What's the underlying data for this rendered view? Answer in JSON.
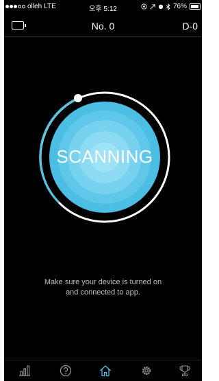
{
  "status_bar": {
    "carrier": "olleh",
    "network": "LTE",
    "time": "오후 5:12",
    "battery_percent": "76%",
    "battery_level": 0.76
  },
  "header": {
    "device_battery_icon": "battery-icon",
    "title": "No. 0",
    "day": "D-0"
  },
  "scanner": {
    "label": "SCANNING",
    "accent_color": "#4fc3e6"
  },
  "message": {
    "line1": "Make sure your device is turned on",
    "line2": "and connected to app."
  },
  "bottom_nav": {
    "items": [
      {
        "icon": "chart-icon",
        "active": false
      },
      {
        "icon": "help-icon",
        "active": false
      },
      {
        "icon": "home-icon",
        "active": true
      },
      {
        "icon": "settings-icon",
        "active": false
      },
      {
        "icon": "trophy-icon",
        "active": false
      }
    ],
    "active_color": "#4fc3e6",
    "inactive_color": "#9a9a9a"
  }
}
